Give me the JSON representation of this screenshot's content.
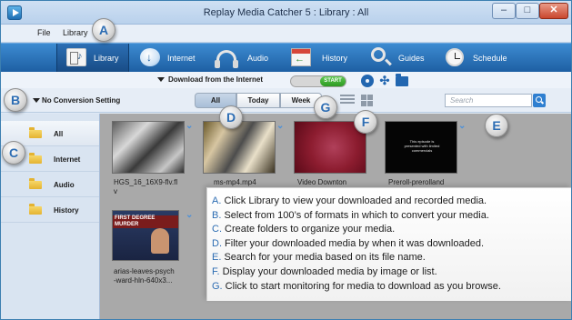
{
  "window": {
    "title": "Replay Media Catcher 5 : Library : All",
    "controls": {
      "minimize": "–",
      "maximize": "□",
      "close": "✕"
    }
  },
  "menu": {
    "items": [
      "File",
      "Library"
    ]
  },
  "nav": {
    "tabs": [
      {
        "label": "Library",
        "icon": "library-icon",
        "active": true
      },
      {
        "label": "Internet",
        "icon": "internet-download-icon",
        "active": false
      },
      {
        "label": "Audio",
        "icon": "headphones-icon",
        "active": false
      },
      {
        "label": "History",
        "icon": "calendar-history-icon",
        "active": false
      },
      {
        "label": "Guides",
        "icon": "magnifier-icon",
        "active": false
      },
      {
        "label": "Schedule",
        "icon": "clock-icon",
        "active": false
      }
    ]
  },
  "toolbar": {
    "download_label": "Download from the Internet",
    "start_label": "START",
    "icons": [
      "gear-icon",
      "compress-icon",
      "folder-icon"
    ]
  },
  "filter": {
    "conversion_label": "No Conversion Setting",
    "segments": [
      "All",
      "Today",
      "Week"
    ],
    "selected": "All",
    "search_placeholder": "Search"
  },
  "sidebar": {
    "folders": [
      {
        "label": "All",
        "active": true
      },
      {
        "label": "Internet",
        "active": false
      },
      {
        "label": "Audio",
        "active": false
      },
      {
        "label": "History",
        "active": false
      }
    ]
  },
  "media": {
    "items": [
      {
        "caption": "HGS_16_16X9-flv.fl\nv"
      },
      {
        "caption": "ms-mp4.mp4"
      },
      {
        "caption": "Video Downton"
      },
      {
        "caption": "Preroll-prerolland"
      },
      {
        "caption": "arias-leaves-psych\n-ward-hln-640x3..."
      }
    ],
    "thumb4_text": "This episode is presented with limited commercials",
    "thumb5_text": "FIRST DEGREE MURDER"
  },
  "callouts": [
    "A",
    "B",
    "C",
    "D",
    "E",
    "F",
    "G"
  ],
  "legend": [
    {
      "key": "A.",
      "text": " Click Library to view your downloaded and recorded media."
    },
    {
      "key": "B.",
      "text": " Select from 100’s of formats in which to convert your media."
    },
    {
      "key": "C.",
      "text": " Create folders to organize your media."
    },
    {
      "key": "D.",
      "text": " Filter your downloaded media by when it was downloaded."
    },
    {
      "key": "E.",
      "text": " Search for your media based on its file name."
    },
    {
      "key": "F.",
      "text": "  Display your downloaded media by image or list."
    },
    {
      "key": "G.",
      "text": " Click to start monitoring for media to download as you browse."
    }
  ],
  "colors": {
    "nav_blue": "#1e5fa3",
    "accent_blue": "#2d6db3",
    "start_green": "#2e9a22",
    "content_gray": "#a9a9a9"
  }
}
